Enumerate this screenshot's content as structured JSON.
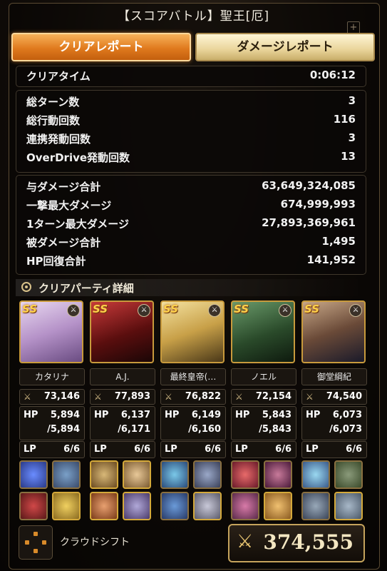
{
  "header": {
    "title": "【スコアバトル】聖王[厄]"
  },
  "tabs": [
    {
      "label": "クリアレポート",
      "active": true
    },
    {
      "label": "ダメージレポート",
      "active": false
    }
  ],
  "clear_time": {
    "label": "クリアタイム",
    "value": "0:06:12"
  },
  "turn_stats": [
    {
      "label": "総ターン数",
      "value": "3"
    },
    {
      "label": "総行動回数",
      "value": "116"
    },
    {
      "label": "連携発動回数",
      "value": "3"
    },
    {
      "label": "OverDrive発動回数",
      "value": "13"
    }
  ],
  "damage_stats": [
    {
      "label": "与ダメージ合計",
      "value": "63,649,324,085"
    },
    {
      "label": "一撃最大ダメージ",
      "value": "674,999,993"
    },
    {
      "label": "1ターン最大ダメージ",
      "value": "27,893,369,961"
    },
    {
      "label": "被ダメージ合計",
      "value": "1,495"
    },
    {
      "label": "HP回復合計",
      "value": "141,952"
    }
  ],
  "party_section": {
    "title": "クリアパーティ詳細"
  },
  "party": [
    {
      "name": "カタリナ",
      "style": "SS",
      "power": "73,146",
      "hp_label": "HP",
      "hp_current": "5,894",
      "hp_max": "/5,894",
      "lp_label": "LP",
      "lp": "6/6",
      "portrait_color": "#c9a8d8"
    },
    {
      "name": "A.J.",
      "style": "SS",
      "power": "77,893",
      "hp_label": "HP",
      "hp_current": "6,137",
      "hp_max": "/6,171",
      "lp_label": "LP",
      "lp": "6/6",
      "portrait_color": "#7a1a1a"
    },
    {
      "name": "最終皇帝(…",
      "style": "SS",
      "power": "76,822",
      "hp_label": "HP",
      "hp_current": "6,149",
      "hp_max": "/6,160",
      "lp_label": "LP",
      "lp": "6/6",
      "portrait_color": "#d8c06a"
    },
    {
      "name": "ノエル",
      "style": "SS",
      "power": "72,154",
      "hp_label": "HP",
      "hp_current": "5,843",
      "hp_max": "/5,843",
      "lp_label": "LP",
      "lp": "6/6",
      "portrait_color": "#3a5a3a"
    },
    {
      "name": "御堂綱紀",
      "style": "SS",
      "power": "74,540",
      "hp_label": "HP",
      "hp_current": "6,073",
      "hp_max": "/6,073",
      "lp_label": "LP",
      "lp": "6/6",
      "portrait_color": "#6a4a38"
    }
  ],
  "footer": {
    "cloud_shift_label": "クラウドシフト",
    "total_power": "374,555"
  },
  "colors": {
    "accent_orange": "#e07a1e",
    "gold": "#c89a3c"
  }
}
